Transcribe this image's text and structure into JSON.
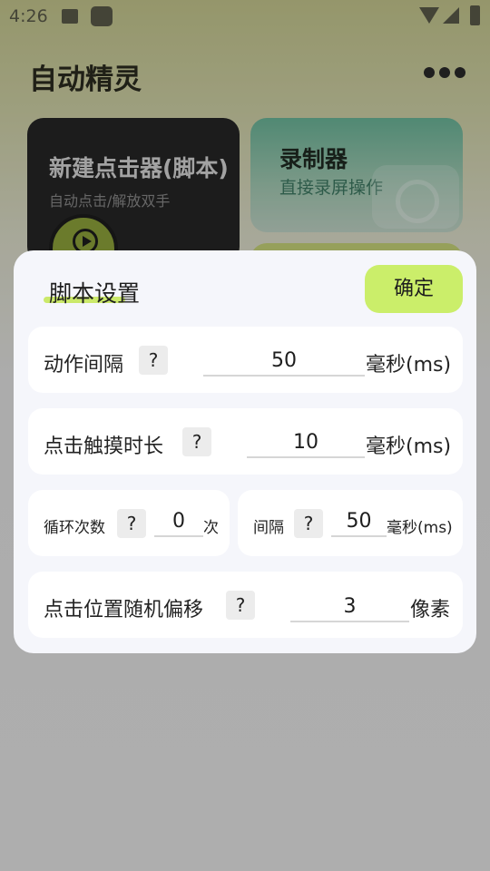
{
  "status_bar": {
    "time": "4:26"
  },
  "app": {
    "title": "自动精灵",
    "cards": {
      "new_clicker": {
        "title": "新建点击器(脚本)",
        "subtitle": "自动点击/解放双手"
      },
      "recorder": {
        "title": "录制器",
        "subtitle": "直接录屏操作"
      }
    }
  },
  "dialog": {
    "title": "脚本设置",
    "confirm_label": "确定",
    "help_symbol": "?",
    "action_interval": {
      "label": "动作间隔",
      "value": "50",
      "unit": "毫秒(ms)"
    },
    "click_duration": {
      "label": "点击触摸时长",
      "value": "10",
      "unit": "毫秒(ms)"
    },
    "loop_count": {
      "label": "循环次数",
      "value": "0",
      "unit": "次"
    },
    "loop_interval": {
      "label": "间隔",
      "value": "50",
      "unit": "毫秒(ms)"
    },
    "random_offset": {
      "label": "点击位置随机偏移",
      "value": "3",
      "unit": "像素"
    }
  },
  "colors": {
    "accent": "#cbee6a",
    "dialog_bg": "#f5f6fb",
    "recorder_card": "#6cb79a"
  }
}
